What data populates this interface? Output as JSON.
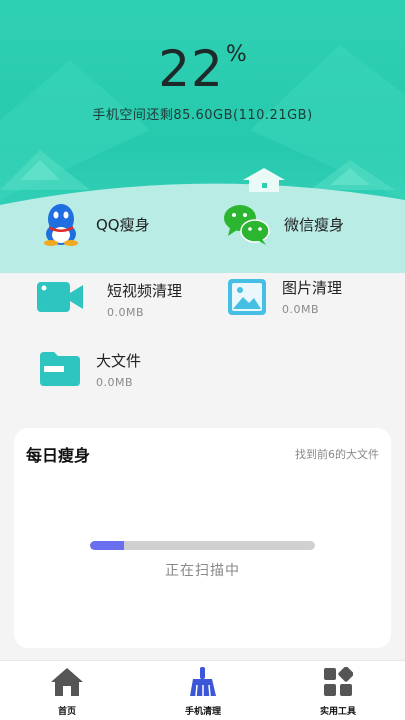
{
  "header": {
    "percent": "22",
    "percent_sign": "%",
    "storage": "手机空间还剩85.60GB(110.21GB)"
  },
  "slim": [
    {
      "label": "QQ瘦身",
      "icon": "qq-penguin-icon"
    },
    {
      "label": "微信瘦身",
      "icon": "wechat-icon"
    }
  ],
  "tools": [
    {
      "title": "短视频清理",
      "size": "0.0MB",
      "icon": "video-camera-icon"
    },
    {
      "title": "图片清理",
      "size": "0.0MB",
      "icon": "image-icon"
    },
    {
      "title": "大文件",
      "size": "0.0MB",
      "icon": "folder-icon"
    }
  ],
  "daily": {
    "title": "每日瘦身",
    "link": "找到前6的大文件",
    "status": "正在扫描中",
    "progress": 0.15
  },
  "tabs": [
    {
      "label": "首页",
      "icon": "home-icon"
    },
    {
      "label": "手机清理",
      "icon": "broom-icon"
    },
    {
      "label": "实用工具",
      "icon": "apps-grid-icon"
    }
  ],
  "colors": {
    "accent": "#27c9ae",
    "progress": "#6a6ff0",
    "qq": "#1f6fe0",
    "wechat": "#2bb530",
    "tool": "#2ec4c0",
    "tabIcon": "#555555",
    "tabActive": "#3b56d6"
  }
}
